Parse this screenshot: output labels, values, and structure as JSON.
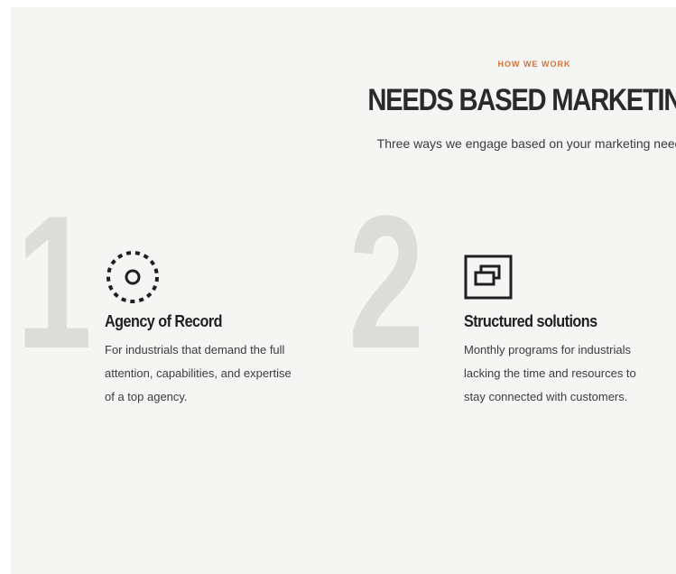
{
  "section": {
    "eyebrow": "HOW WE WORK",
    "title": "NEEDS BASED MARKETING",
    "subtitle": "Three ways we engage based on your marketing needs."
  },
  "cards": [
    {
      "number": "1",
      "icon": "dashed-circle-target-icon",
      "title": "Agency of Record",
      "description_lines": [
        "For industrials that demand the full",
        "attention, capabilities, and expertise",
        "of a top agency."
      ]
    },
    {
      "number": "2",
      "icon": "stacked-windows-icon",
      "title": "Structured solutions",
      "description_lines": [
        "Monthly programs for industrials",
        "lacking the time and resources to",
        "stay connected with customers."
      ]
    }
  ],
  "colors": {
    "background": "#f5f5f4",
    "accent": "#d0763b",
    "heading": "#2a2a2a",
    "number": "#dcdcd8",
    "icon": "#1f1f1f"
  }
}
